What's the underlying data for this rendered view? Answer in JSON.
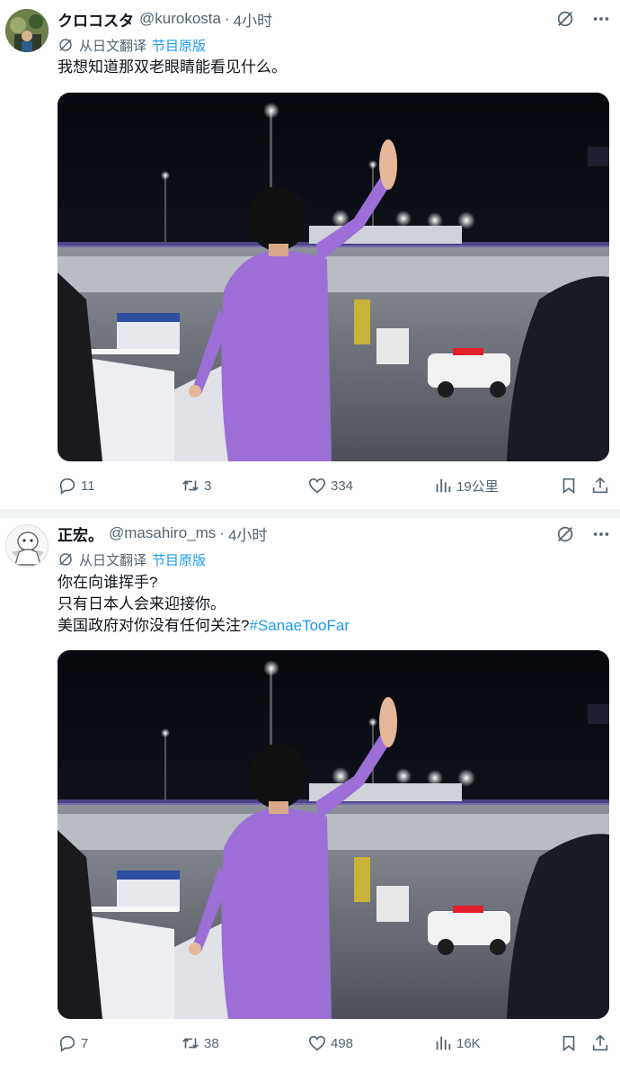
{
  "posts": [
    {
      "name": "クロコスタ",
      "handle": "@kurokosta",
      "separator": "·",
      "time": "4小时",
      "translate_label": "从日文翻译",
      "original_label": "节目原版",
      "lines": [
        "我想知道那双老眼睛能看见什么。"
      ],
      "stats": {
        "replies": "11",
        "reposts": "3",
        "likes": "334",
        "views": "19公里"
      }
    },
    {
      "name": "正宏。",
      "handle": "@masahiro_ms",
      "separator": "·",
      "time": "4小时",
      "translate_label": "从日文翻译",
      "original_label": "节目原版",
      "lines": [
        "你在向谁挥手?",
        "只有日本人会来迎接你。",
        "美国政府对你没有任何关注?"
      ],
      "hashtag": "#SanaeTooFar",
      "stats": {
        "replies": "7",
        "reposts": "38",
        "likes": "498",
        "views": "16K"
      }
    }
  ],
  "icons": {
    "translate": "translate-icon",
    "grok": "grok-icon",
    "more": "more-icon",
    "reply": "reply-icon",
    "repost": "repost-icon",
    "like": "heart-icon",
    "views": "views-icon",
    "bookmark": "bookmark-icon",
    "share": "share-icon"
  },
  "colors": {
    "text": "#0f1419",
    "secondary": "#536471",
    "link": "#1d9bf0",
    "separator": "#eff3f4",
    "suit": "#9b6fd6"
  }
}
